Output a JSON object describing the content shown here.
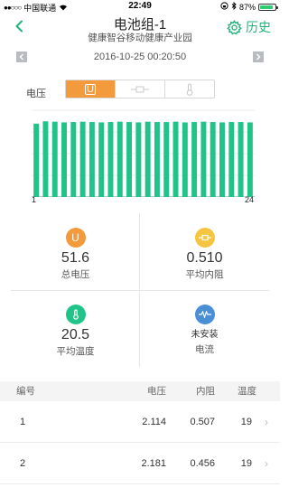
{
  "status": {
    "carrier": "中国联通",
    "time": "22:49",
    "battery": "87%",
    "battery_level": 0.87
  },
  "nav": {
    "title": "电池组-1",
    "subtitle": "健康智谷移动健康产业园",
    "history": "历史"
  },
  "date": "2016-10-25 00:20:50",
  "segment": {
    "label": "电压",
    "active_text": "U"
  },
  "chart_data": {
    "type": "bar",
    "categories": [
      "1",
      "2",
      "3",
      "4",
      "5",
      "6",
      "7",
      "8",
      "9",
      "10",
      "11",
      "12",
      "13",
      "14",
      "15",
      "16",
      "17",
      "18",
      "19",
      "20",
      "21",
      "22",
      "23",
      "24"
    ],
    "values": [
      2.114,
      2.181,
      2.17,
      2.15,
      2.16,
      2.17,
      2.16,
      2.15,
      2.16,
      2.17,
      2.16,
      2.15,
      2.17,
      2.16,
      2.16,
      2.17,
      2.15,
      2.16,
      2.17,
      2.16,
      2.15,
      2.16,
      2.16,
      2.15
    ],
    "x_tick_labels": [
      "1",
      "24"
    ],
    "ylim": [
      0,
      2.5
    ],
    "color": "#22c389"
  },
  "stats": [
    {
      "value": "51.6",
      "label": "总电压",
      "icon": "voltage-icon",
      "color": "#f39a3c"
    },
    {
      "value": "0.510",
      "label": "平均内阻",
      "icon": "resistance-icon",
      "color": "#f5c542"
    },
    {
      "value": "20.5",
      "label": "平均温度",
      "icon": "thermometer-icon",
      "color": "#22c389"
    },
    {
      "value": "未安装",
      "label": "电流",
      "icon": "current-wave-icon",
      "color": "#4a8fd6"
    }
  ],
  "table": {
    "headers": [
      "编号",
      "电压",
      "内阻",
      "温度"
    ],
    "rows": [
      {
        "no": "1",
        "voltage": "2.114",
        "resistance": "0.507",
        "temp": "19"
      },
      {
        "no": "2",
        "voltage": "2.181",
        "resistance": "0.456",
        "temp": "19"
      }
    ]
  }
}
